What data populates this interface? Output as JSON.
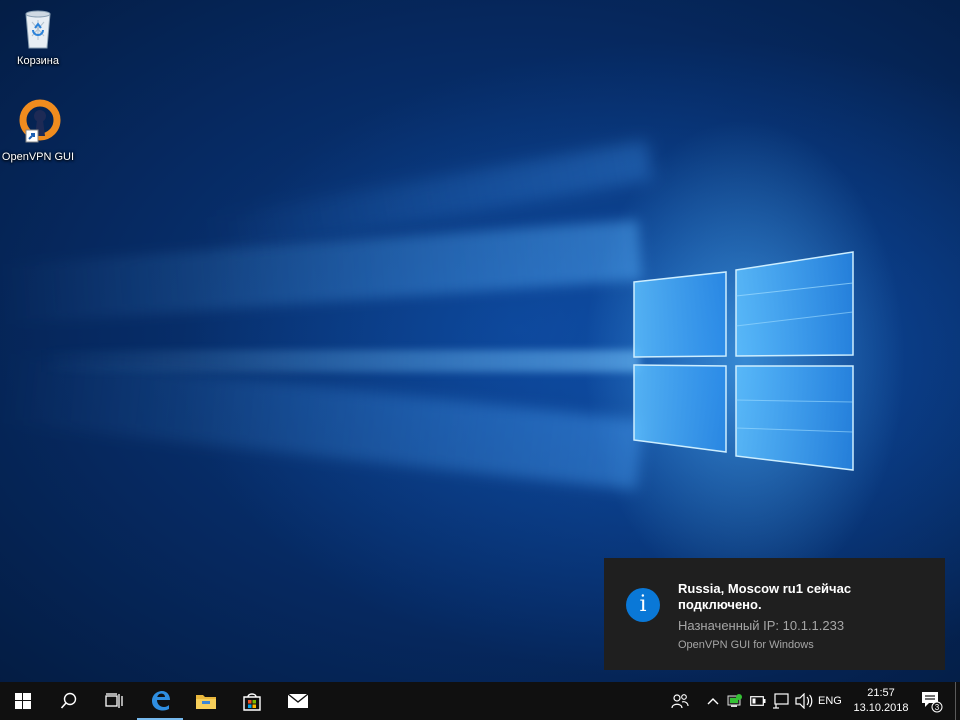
{
  "desktop": {
    "icons": [
      {
        "label": "Корзина",
        "icon": "recycle-bin-icon"
      },
      {
        "label": "OpenVPN GUI",
        "icon": "openvpn-icon"
      }
    ]
  },
  "notification": {
    "icon": "info-icon",
    "title": "Russia, Moscow ru1 сейчас подключено.",
    "body": "Назначенный IP: 10.1.1.233",
    "source": "OpenVPN GUI for Windows",
    "info_glyph": "i"
  },
  "taskbar": {
    "pinned": [
      "start-icon",
      "search-icon",
      "task-view-icon",
      "edge-icon",
      "file-explorer-icon",
      "store-icon",
      "mail-icon"
    ],
    "tray": {
      "icons": [
        "people-icon",
        "chevron-up-icon",
        "openvpn-tray-icon",
        "battery-icon",
        "network-icon",
        "volume-icon"
      ],
      "language": "ENG",
      "time": "21:57",
      "date": "13.10.2018",
      "notification_count": "3"
    }
  },
  "colors": {
    "accent": "#0a78d7",
    "taskbar": "#101010",
    "toast_background": "#1f1f1f",
    "openvpn_orange": "#f08c1e"
  }
}
